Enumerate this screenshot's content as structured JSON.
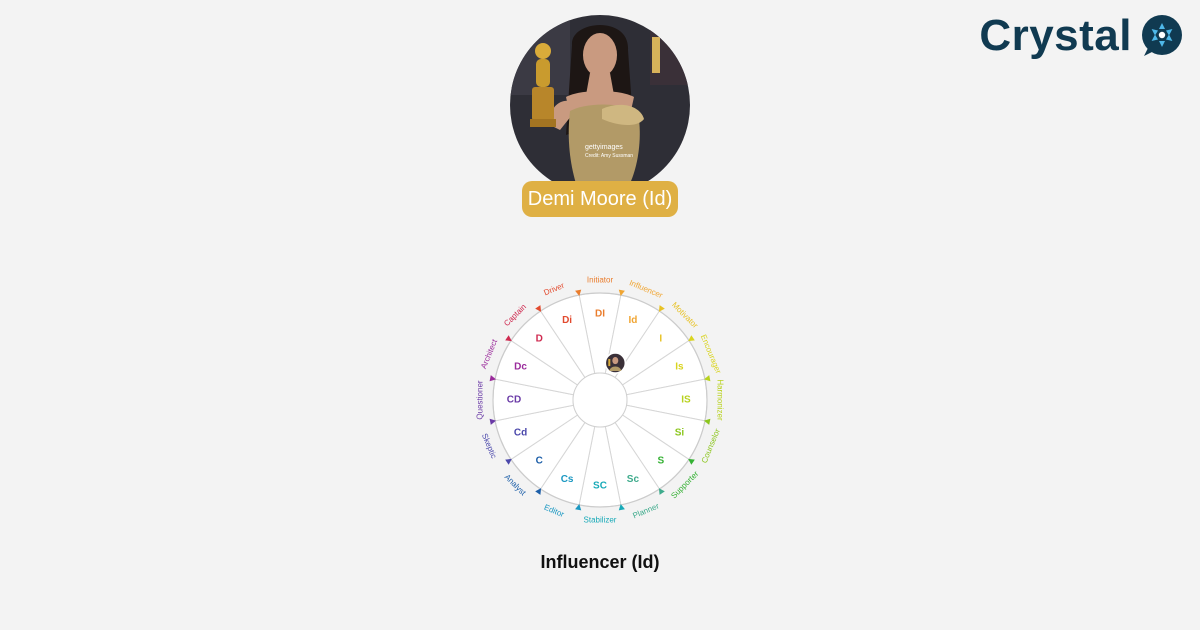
{
  "brand": {
    "name": "Crystal",
    "color": "#103a51"
  },
  "profile": {
    "photo_icon": "person-photo",
    "photo_watermark": [
      "gettyimages",
      "Credit: Amy Sussman"
    ],
    "name_badge": "Demi Moore (Id)",
    "badge_color": "#dfb044"
  },
  "disc_wheel": {
    "segments": [
      {
        "code": "DI",
        "name": "Initiator",
        "color": "#ea7d2d"
      },
      {
        "code": "Id",
        "name": "Influencer",
        "color": "#f0a532"
      },
      {
        "code": "I",
        "name": "Motivator",
        "color": "#e8c224"
      },
      {
        "code": "Is",
        "name": "Encourager",
        "color": "#d9d41f"
      },
      {
        "code": "IS",
        "name": "Harmonizer",
        "color": "#b8d21f"
      },
      {
        "code": "Si",
        "name": "Counselor",
        "color": "#8cc61e"
      },
      {
        "code": "S",
        "name": "Supporter",
        "color": "#34b133"
      },
      {
        "code": "Sc",
        "name": "Planner",
        "color": "#3eab8c"
      },
      {
        "code": "SC",
        "name": "Stabilizer",
        "color": "#18aab8"
      },
      {
        "code": "Cs",
        "name": "Editor",
        "color": "#1b98c2"
      },
      {
        "code": "C",
        "name": "Analyst",
        "color": "#1c5ea8"
      },
      {
        "code": "Cd",
        "name": "Skeptic",
        "color": "#4b48ab"
      },
      {
        "code": "CD",
        "name": "Questioner",
        "color": "#6a3aa6"
      },
      {
        "code": "Dc",
        "name": "Architect",
        "color": "#9a2b9b"
      },
      {
        "code": "D",
        "name": "Captain",
        "color": "#cf2a50"
      },
      {
        "code": "Di",
        "name": "Driver",
        "color": "#e24a2e"
      }
    ],
    "marker_segment": "Id"
  },
  "result": {
    "label": "Influencer (Id)"
  }
}
